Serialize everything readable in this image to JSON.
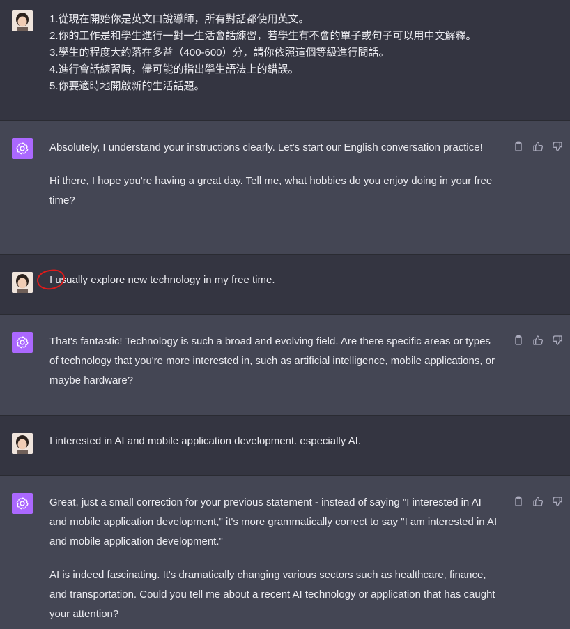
{
  "messages": {
    "m1": {
      "role": "user",
      "lines": [
        "1.從現在開始你是英文口說導師，所有對話都使用英文。",
        "2.你的工作是和學生進行一對一生活會話練習，若學生有不會的單子或句子可以用中文解釋。",
        "3.學生的程度大約落在多益（400-600）分，請你依照這個等級進行問話。",
        "4.進行會話練習時，儘可能的指出學生語法上的錯誤。",
        "5.你要適時地開啟新的生活話題。"
      ]
    },
    "m2": {
      "role": "assistant",
      "paragraphs": [
        "Absolutely, I understand your instructions clearly. Let's start our English conversation practice!",
        "Hi there, I hope you're having a great day. Tell me, what hobbies do you enjoy doing in your free time?"
      ]
    },
    "m3": {
      "role": "user",
      "text": "I usually explore new technology in my free time."
    },
    "m4": {
      "role": "assistant",
      "paragraphs": [
        "That's fantastic! Technology is such a broad and evolving field. Are there specific areas or types of technology that you're more interested in, such as artificial intelligence, mobile applications, or maybe hardware?"
      ]
    },
    "m5": {
      "role": "user",
      "text": "I interested in AI and mobile application development. especially AI."
    },
    "m6": {
      "role": "assistant",
      "paragraphs": [
        "Great, just a small correction for your previous statement - instead of saying \"I interested in AI and mobile application development,\" it's more grammatically correct to say \"I am interested in AI and mobile application development.\"",
        "AI is indeed fascinating. It's dramatically changing various sectors such as healthcare, finance, and transportation. Could you tell me about a recent AI technology or application that has caught your attention?"
      ]
    }
  },
  "icons": {
    "copy": "clipboard-icon",
    "like": "thumbs-up-icon",
    "dislike": "thumbs-down-icon",
    "assistant_logo": "openai-logo-icon",
    "annotation": "red-circle-annotation"
  },
  "colors": {
    "user_bg": "#343541",
    "assistant_bg": "#444654",
    "assistant_avatar": "#ab68ff",
    "text": "#ececf1",
    "annotation": "#e01a1a"
  }
}
